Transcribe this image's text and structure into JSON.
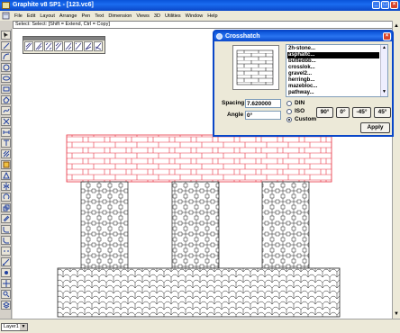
{
  "window": {
    "title": "Graphite v8 SP1 - [123.vc6]"
  },
  "menu": {
    "items": [
      "File",
      "Edit",
      "Layout",
      "Arrange",
      "Pen",
      "Text",
      "Dimension",
      "Views",
      "3D",
      "Utilities",
      "Window",
      "Help"
    ]
  },
  "prompt": {
    "text": "Select: Select: [Shift = Extend, Ctrl = Copy]"
  },
  "dialog": {
    "title": "Crosshatch",
    "patterns": [
      "2h-stone...",
      "asphaltc...",
      "buttedbb...",
      "crosslok...",
      "gravel2...",
      "herringb...",
      "mazebloc...",
      "pathway..."
    ],
    "selected_index": 1,
    "spacing_label": "Spacing",
    "spacing_value": "7.620000",
    "angle_label": "Angle",
    "angle_value": "0°",
    "radio_din": "DIN",
    "radio_iso": "ISO",
    "radio_custom": "Custom",
    "selected_radio": "Custom",
    "btn_90": "90°",
    "btn_0": "0°",
    "btn_m45": "-45°",
    "btn_45": "45°",
    "apply_label": "Apply"
  },
  "layer": {
    "value": "Layer1"
  },
  "colors": {
    "hatch_red": "#e83040",
    "line_dark": "#202020",
    "titlebar": "#0a53d8"
  }
}
